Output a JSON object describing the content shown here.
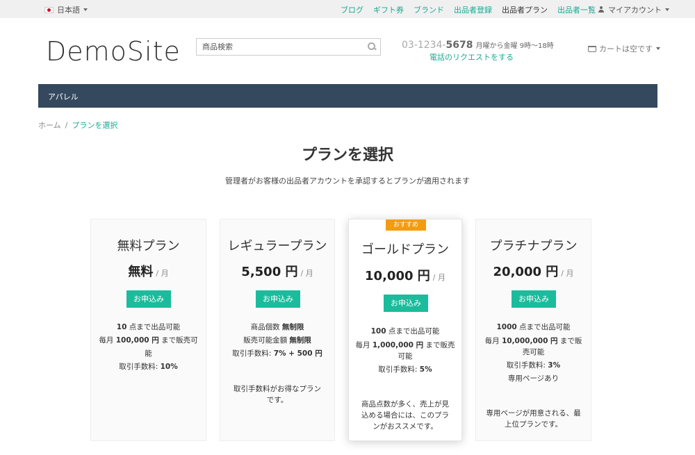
{
  "topbar": {
    "language": "日本語",
    "links": [
      "ブログ",
      "ギフト券",
      "ブランド",
      "出品者登録",
      "出品者プラン",
      "出品者一覧"
    ],
    "account": "マイアカウント"
  },
  "header": {
    "logo": "DemoSite",
    "search_placeholder": "商品検索",
    "phone_prefix": "03-1234-",
    "phone_main": "5678",
    "hours": "月曜から金曜 9時〜18時",
    "phone_request": "電話のリクエストをする",
    "cart": "カートは空です"
  },
  "nav": {
    "item": "アパレル"
  },
  "breadcrumb": {
    "home": "ホーム",
    "separator": "/",
    "current": "プランを選択"
  },
  "page": {
    "title": "プランを選択",
    "description": "管理者がお客様の出品者アカウントを承認するとプランが適用されます"
  },
  "plans": [
    {
      "name": "無料プラン",
      "price": "無料",
      "unit": "/ 月",
      "button": "お申込み",
      "f1a": "10",
      "f1b": " 点まで出品可能",
      "f2a": "毎月 ",
      "f2b": "100,000 円",
      "f2c": " まで販売可能",
      "f3a": "取引手数料: ",
      "f3b": "10%"
    },
    {
      "name": "レギュラープラン",
      "price": "5,500 円",
      "unit": "/ 月",
      "button": "お申込み",
      "f1a": "商品個数 ",
      "f1b": "無制限",
      "f2a": "販売可能金額 ",
      "f2b": "無制限",
      "f3a": "取引手数料: ",
      "f3b": "7% + 500 円",
      "note": "取引手数料がお得なプランです。"
    },
    {
      "name": "ゴールドプラン",
      "badge": "おすすめ",
      "price": "10,000 円",
      "unit": "/ 月",
      "button": "お申込み",
      "f1a": "100",
      "f1b": " 点まで出品可能",
      "f2a": "毎月 ",
      "f2b": "1,000,000 円",
      "f2c": " まで販売可能",
      "f3a": "取引手数料: ",
      "f3b": "5%",
      "note": "商品点数が多く、売上が見込める場合には、このプランがおススメです。"
    },
    {
      "name": "プラチナプラン",
      "price": "20,000 円",
      "unit": "/ 月",
      "button": "お申込み",
      "f1a": "1000",
      "f1b": " 点まで出品可能",
      "f2a": "毎月 ",
      "f2b": "10,000,000 円",
      "f2c": " まで販売可能",
      "f3a": "取引手数料: ",
      "f3b": "3%",
      "f4": "専用ページあり",
      "note": "専用ページが用意される、最上位プランです。"
    }
  ]
}
